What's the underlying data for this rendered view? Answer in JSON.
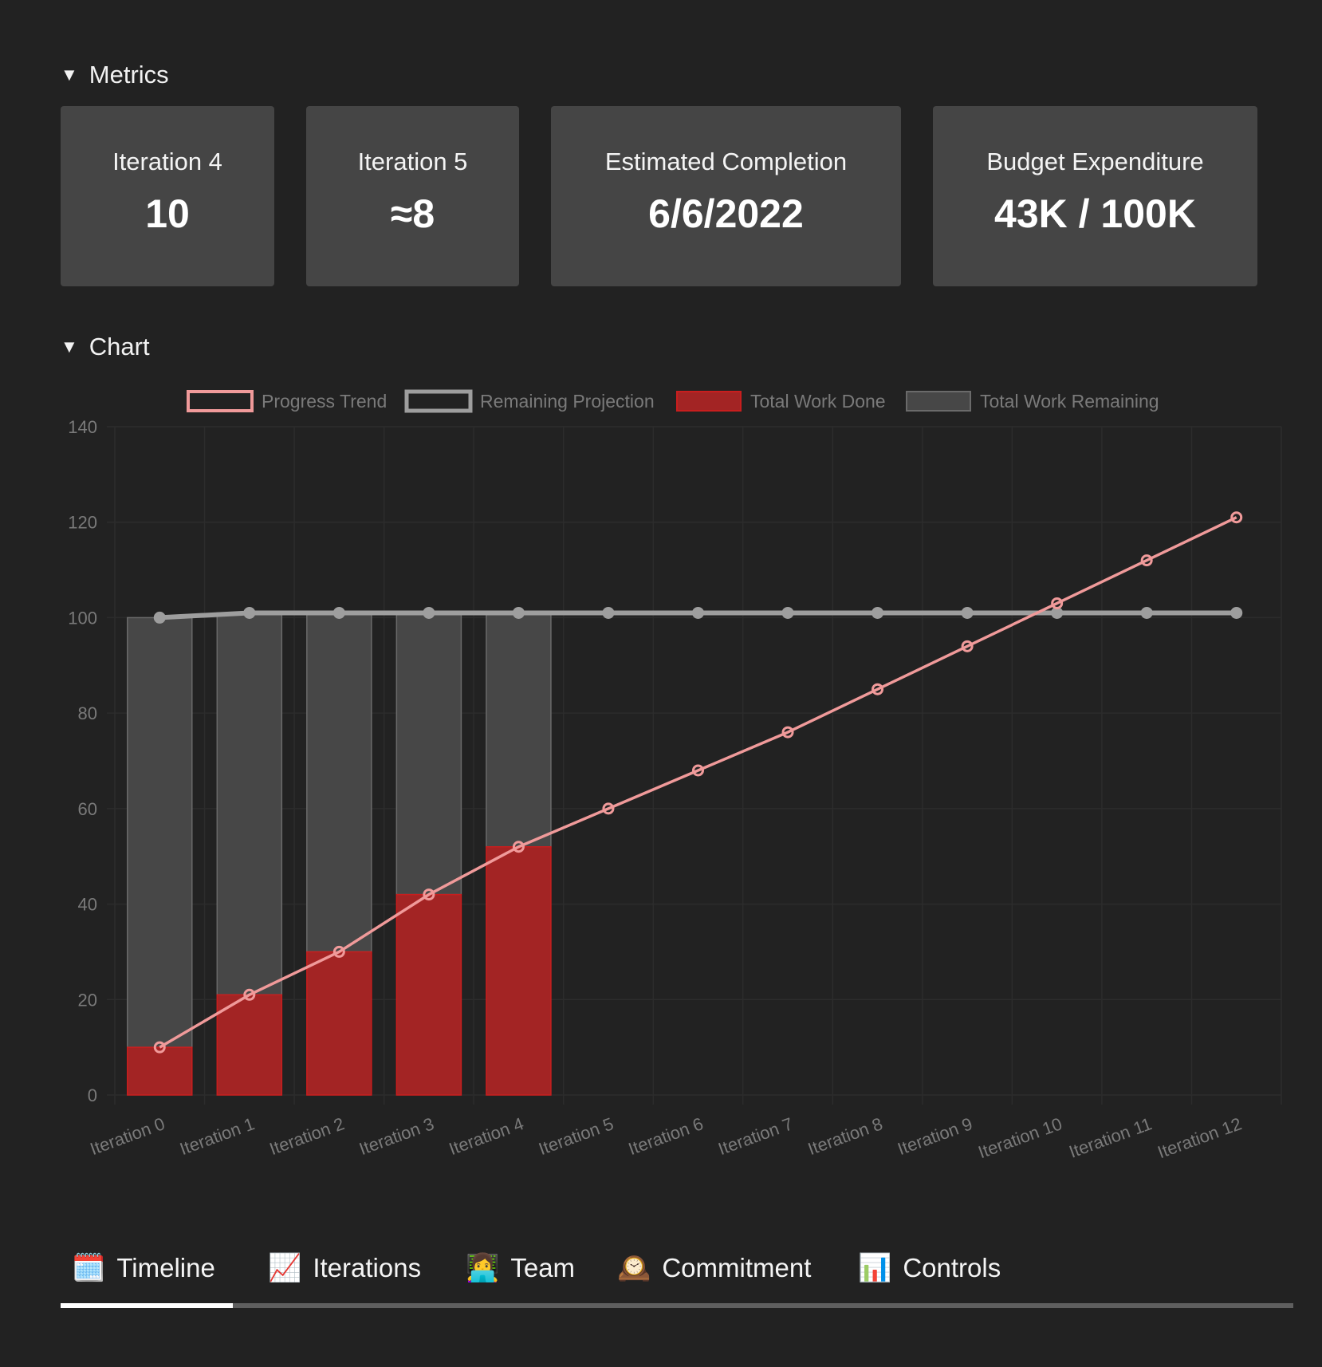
{
  "metrics": {
    "header": "Metrics",
    "cards": [
      {
        "title": "Iteration 4",
        "value": "10"
      },
      {
        "title": "Iteration 5",
        "value": "≈8"
      },
      {
        "title": "Estimated Completion",
        "value": "6/6/2022"
      },
      {
        "title": "Budget Expenditure",
        "value": "43K / 100K"
      }
    ]
  },
  "chart_section": {
    "header": "Chart"
  },
  "colors": {
    "background": "#222222",
    "card": "#454545",
    "progress_trend": "#f09a9a",
    "remaining_projection": "#9e9e9e",
    "work_done": "#a32424",
    "work_done_border": "#c81e1e",
    "work_remaining": "#474747",
    "work_remaining_border": "#6a6a6a",
    "grid": "#2c2c2c",
    "tick": "#7a7a7a"
  },
  "chart_data": {
    "type": "bar",
    "title": "",
    "xlabel": "",
    "ylabel": "",
    "ylim": [
      0,
      140
    ],
    "yticks": [
      0,
      20,
      40,
      60,
      80,
      100,
      120,
      140
    ],
    "grid": true,
    "legend_position": "top-center",
    "categories": [
      "Iteration 0",
      "Iteration 1",
      "Iteration 2",
      "Iteration 3",
      "Iteration 4",
      "Iteration 5",
      "Iteration 6",
      "Iteration 7",
      "Iteration 8",
      "Iteration 9",
      "Iteration 10",
      "Iteration 11",
      "Iteration 12"
    ],
    "series": [
      {
        "name": "Progress Trend",
        "type": "line",
        "values": [
          10,
          21,
          30,
          42,
          52,
          60,
          68,
          76,
          85,
          94,
          103,
          112,
          121
        ]
      },
      {
        "name": "Remaining Projection",
        "type": "line",
        "values": [
          100,
          101,
          101,
          101,
          101,
          101,
          101,
          101,
          101,
          101,
          101,
          101,
          101
        ]
      },
      {
        "name": "Total Work Done",
        "type": "bar",
        "stack": "work",
        "values": [
          10,
          21,
          30,
          42,
          52,
          null,
          null,
          null,
          null,
          null,
          null,
          null,
          null
        ]
      },
      {
        "name": "Total Work Remaining",
        "type": "bar",
        "stack": "work",
        "values": [
          90,
          80,
          71,
          59,
          49,
          null,
          null,
          null,
          null,
          null,
          null,
          null,
          null
        ]
      }
    ]
  },
  "tabs": [
    {
      "icon": "🗓️",
      "icon_name": "calendar-icon",
      "label": "Timeline",
      "active": true
    },
    {
      "icon": "📈",
      "icon_name": "chart-increasing-icon",
      "label": "Iterations",
      "active": false
    },
    {
      "icon": "👩‍💻",
      "icon_name": "technologist-icon",
      "label": "Team",
      "active": false
    },
    {
      "icon": "🕰️",
      "icon_name": "mantelpiece-clock-icon",
      "label": "Commitment",
      "active": false
    },
    {
      "icon": "📊",
      "icon_name": "bar-chart-icon",
      "label": "Controls",
      "active": false
    }
  ]
}
